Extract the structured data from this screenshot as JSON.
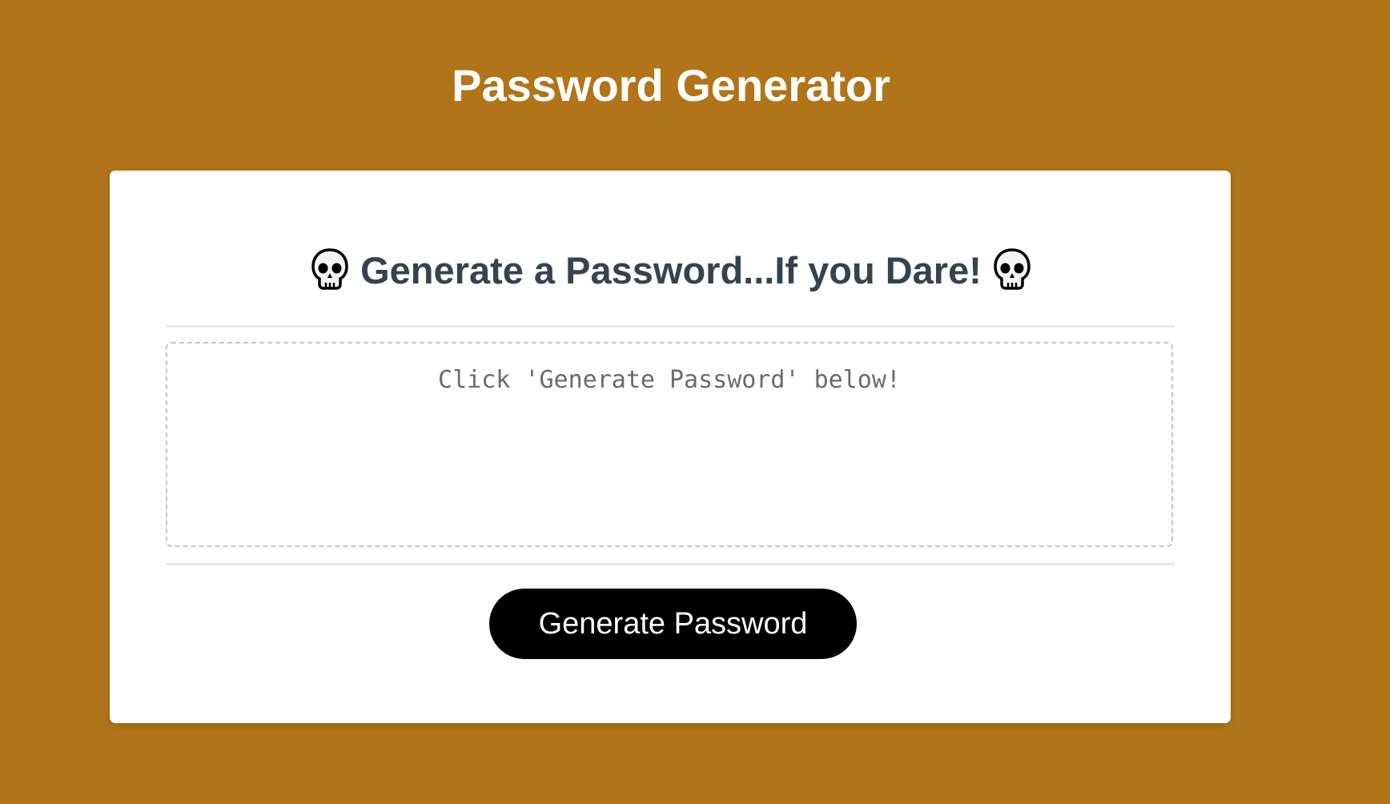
{
  "header": {
    "title": "Password Generator"
  },
  "card": {
    "title": "Generate a Password...If you Dare!",
    "title_icon": "skull-icon",
    "password_placeholder": "Click 'Generate Password' below!",
    "password_value": "",
    "generate_button_label": "Generate Password"
  },
  "colors": {
    "background": "#b27418",
    "card": "#ffffff",
    "title_text": "#36434f",
    "button": "#000000",
    "button_text": "#ffffff"
  }
}
